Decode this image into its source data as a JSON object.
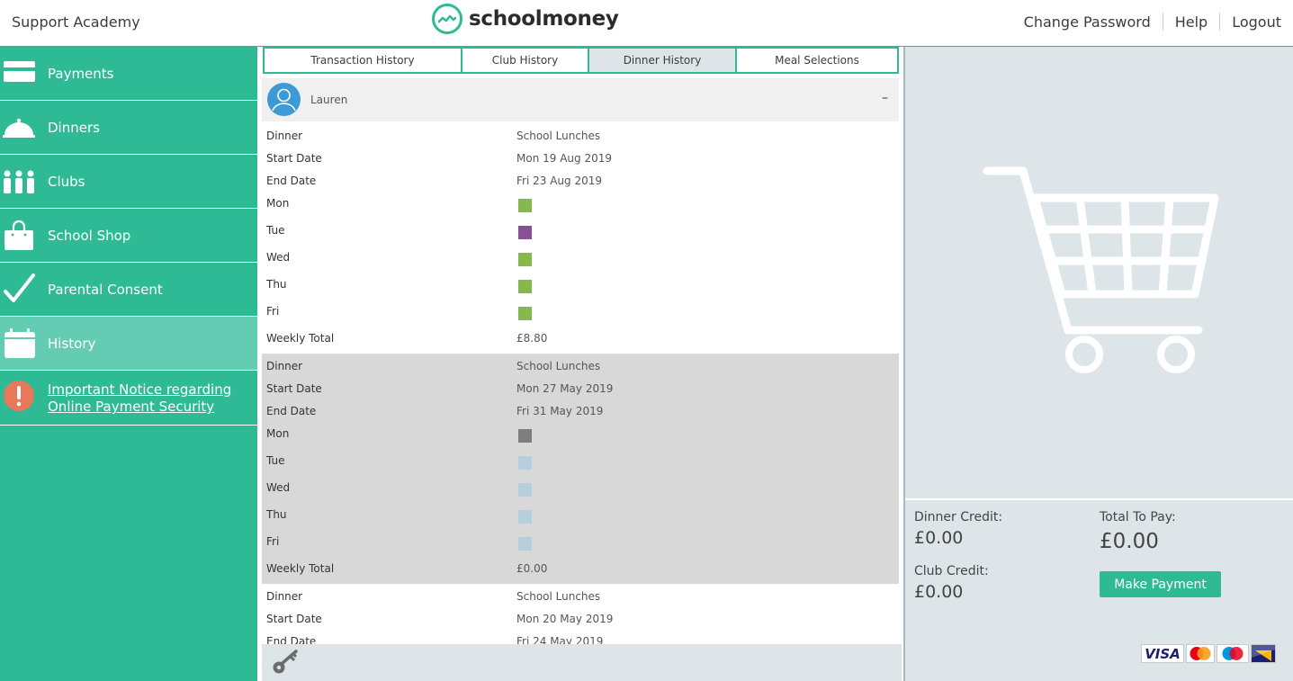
{
  "header": {
    "school_name": "Support Academy",
    "logo_text": "schoolmoney",
    "links": {
      "change_password": "Change Password",
      "help": "Help",
      "logout": "Logout"
    }
  },
  "sidebar": {
    "items": [
      {
        "label": "Payments",
        "icon": "card-icon"
      },
      {
        "label": "Dinners",
        "icon": "cloche-icon"
      },
      {
        "label": "Clubs",
        "icon": "people-icon"
      },
      {
        "label": "School Shop",
        "icon": "shopping-bag-icon"
      },
      {
        "label": "Parental Consent",
        "icon": "checkmark-icon"
      },
      {
        "label": "History",
        "icon": "calendar-icon",
        "active": true
      }
    ],
    "notice": {
      "line1": "Important Notice regarding",
      "line2": "Online Payment Security",
      "icon": "alert-icon"
    }
  },
  "tabs": [
    {
      "label": "Transaction History"
    },
    {
      "label": "Club History"
    },
    {
      "label": "Dinner History",
      "active": true
    },
    {
      "label": "Meal Selections"
    }
  ],
  "child": {
    "name": "Lauren",
    "collapse": "–"
  },
  "labels": {
    "dinner": "Dinner",
    "start_date": "Start Date",
    "end_date": "End Date",
    "mon": "Mon",
    "tue": "Tue",
    "wed": "Wed",
    "thu": "Thu",
    "fri": "Fri",
    "weekly_total": "Weekly Total"
  },
  "colors": {
    "brand": "#2fba96",
    "day_green": "#86b84c",
    "day_purple": "#8a4f97",
    "day_grey": "#7f7f7f",
    "day_lightblue": "#b6cfdd"
  },
  "records": [
    {
      "dinner": "School Lunches",
      "start_date": "Mon 19 Aug 2019",
      "end_date": "Fri 23 Aug 2019",
      "weekly_total": "£8.80"
    },
    {
      "dinner": "School Lunches",
      "start_date": "Mon 27 May 2019",
      "end_date": "Fri 31 May 2019",
      "weekly_total": "£0.00"
    },
    {
      "dinner": "School Lunches",
      "start_date": "Mon 20 May 2019",
      "end_date": "Fri 24 May 2019"
    }
  ],
  "basket": {
    "dinner_credit_label": "Dinner Credit:",
    "dinner_credit": "£0.00",
    "club_credit_label": "Club Credit:",
    "club_credit": "£0.00",
    "total_label": "Total To Pay:",
    "total": "£0.00",
    "make_payment": "Make Payment"
  },
  "payment_cards": {
    "visa": "VISA",
    "maestro": "Maestro",
    "mastercard": "MasterCard",
    "delta": "DELTA"
  }
}
